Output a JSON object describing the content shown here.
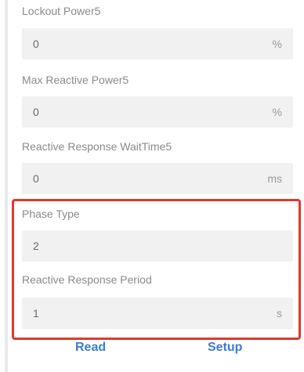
{
  "fields": [
    {
      "label": "Lockout Power5",
      "value": "0",
      "unit": "%"
    },
    {
      "label": "Max Reactive Power5",
      "value": "0",
      "unit": "%"
    },
    {
      "label": "Reactive Response WaitTime5",
      "value": "0",
      "unit": "ms"
    },
    {
      "label": "Phase Type",
      "value": "2",
      "unit": ""
    },
    {
      "label": "Reactive Response Period",
      "value": "1",
      "unit": "s"
    }
  ],
  "actions": {
    "read_label": "Read",
    "setup_label": "Setup"
  },
  "colors": {
    "highlight": "#e0382c",
    "accent": "#3a7bd5",
    "field_bg": "#f1f1f1"
  }
}
